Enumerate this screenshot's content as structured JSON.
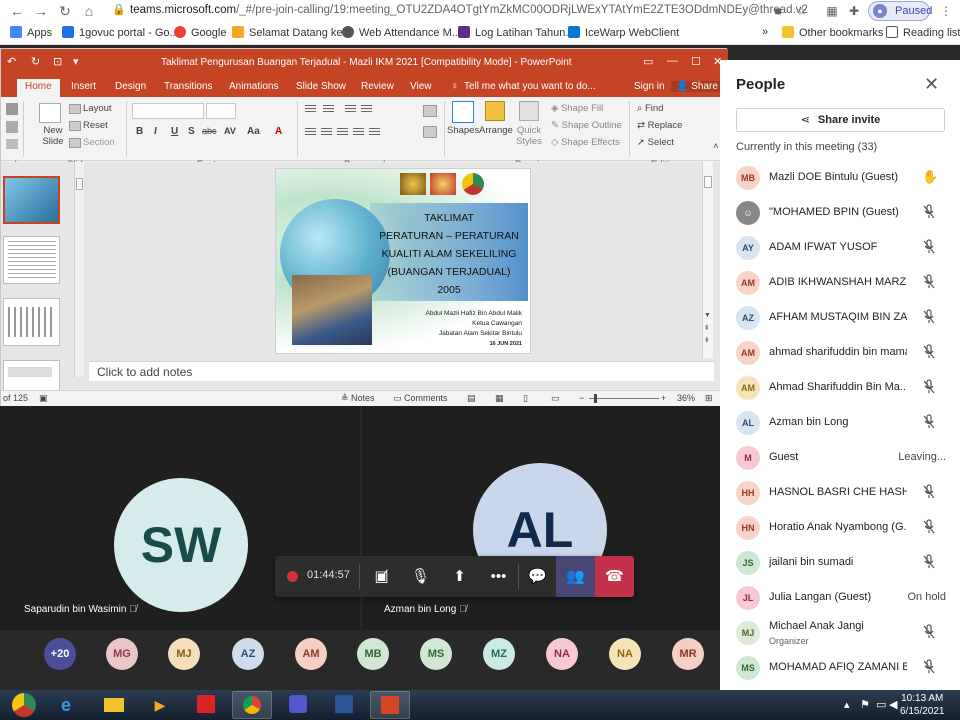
{
  "browser": {
    "url_main": "teams.microsoft.com",
    "url_rest": "/_#/pre-join-calling/19:meeting_OTU2ZDA4OTgtYmZkMC00ODRjLWExYTAtYmE2ZTE3ODdmNDEy@thread.v2",
    "paused_label": "Paused",
    "bookmarks": [
      {
        "label": "Apps",
        "color": "#4285f4"
      },
      {
        "label": "1govuc portal - Go...",
        "color": "#1a73e8"
      },
      {
        "label": "Google",
        "color": "#ea4335"
      },
      {
        "label": "Selamat Datang ke...",
        "color": "#f9a825"
      },
      {
        "label": "Web Attendance M...",
        "color": "#555555"
      },
      {
        "label": "Log Latihan Tahun...",
        "color": "#5c2d91"
      },
      {
        "label": "IceWarp WebClient",
        "color": "#0078d4"
      }
    ],
    "other_bookmarks": "Other bookmarks",
    "reading_list": "Reading list",
    "more": "»"
  },
  "ppt": {
    "title": "Taklimat Pengurusan Buangan Terjadual - Mazli IKM 2021 [Compatibility Mode] - PowerPoint",
    "tabs": [
      "Home",
      "Insert",
      "Design",
      "Transitions",
      "Animations",
      "Slide Show",
      "Review",
      "View"
    ],
    "tell_me": "Tell me what you want to do...",
    "sign_in": "Sign in",
    "share": "Share",
    "ribbon": {
      "new_slide": "New Slide",
      "layout": "Layout",
      "reset": "Reset",
      "section": "Section",
      "slides_group": "Slides",
      "font_group": "Font",
      "paragraph_group": "Paragraph",
      "shapes": "Shapes",
      "arrange": "Arrange",
      "quick_styles": "Quick Styles",
      "shape_fill": "Shape Fill",
      "shape_outline": "Shape Outline",
      "shape_effects": "Shape Effects",
      "drawing_group": "Drawing",
      "find": "Find",
      "replace": "Replace",
      "select": "Select",
      "editing_group": "Editing",
      "clipboard_group": "ard"
    },
    "slide": {
      "line1": "TAKLIMAT",
      "line2": "PERATURAN – PERATURAN",
      "line3": "KUALITI ALAM SEKELILING",
      "line4": "(BUANGAN TERJADUAL)",
      "line5": "2005",
      "presenter": "Abdul Mazli Hafiz Bin Abdul Malik",
      "position": "Ketua Cawangan",
      "department": "Jabatan Alam Sekitar Bintulu",
      "date": "16 JUN 2021"
    },
    "notes_placeholder": "Click to add notes",
    "status": {
      "slide_count": "of 125",
      "notes": "Notes",
      "comments": "Comments",
      "zoom": "36%"
    }
  },
  "meeting": {
    "timer": "01:44:57",
    "tiles": [
      {
        "initials": "SW",
        "name": "Saparudin bin Wasimin"
      },
      {
        "initials": "AL",
        "name": "Azman bin Long"
      }
    ],
    "overflow_count": "+20",
    "row_avatars": [
      {
        "initials": "MG",
        "bg": "#e9c6c8",
        "fg": "#8a3a42"
      },
      {
        "initials": "MJ",
        "bg": "#f6dfbb",
        "fg": "#8a5a12"
      },
      {
        "initials": "AZ",
        "bg": "#cfdcec",
        "fg": "#2e4d72"
      },
      {
        "initials": "AM",
        "bg": "#f5cfc2",
        "fg": "#8a3a22"
      },
      {
        "initials": "MB",
        "bg": "#cfe7d3",
        "fg": "#2d6a3a"
      },
      {
        "initials": "MS",
        "bg": "#cfe7d3",
        "fg": "#2d6a3a"
      },
      {
        "initials": "MZ",
        "bg": "#c9ebe3",
        "fg": "#1f6e5c"
      },
      {
        "initials": "NA",
        "bg": "#f7c9d3",
        "fg": "#8a2e45"
      },
      {
        "initials": "NA",
        "bg": "#f6e3b9",
        "fg": "#8a6a12"
      },
      {
        "initials": "MR",
        "bg": "#f5cfc2",
        "fg": "#8a3a22"
      }
    ]
  },
  "people": {
    "title": "People",
    "share_invite": "Share invite",
    "currently": "Currently in this meeting (33)",
    "participants": [
      {
        "initials": "MB",
        "name": "Mazli DOE Bintulu (Guest)",
        "status": "hand",
        "bg": "#f8d4c8",
        "fg": "#9a3a22"
      },
      {
        "initials": "",
        "name": "\"MOHAMED BPIN (Guest)",
        "status": "muted",
        "bg": "#8a8886",
        "fg": "#ffffff"
      },
      {
        "initials": "AY",
        "name": "ADAM IFWAT YUSOF",
        "status": "muted",
        "bg": "#d8e4f0",
        "fg": "#2e4d72"
      },
      {
        "initials": "AM",
        "name": "ADIB IKHWANSHAH MARZU...",
        "status": "muted",
        "bg": "#f8d4c8",
        "fg": "#9a3a22"
      },
      {
        "initials": "AZ",
        "name": "AFHAM MUSTAQIM BIN ZA...",
        "status": "muted",
        "bg": "#d8e4f0",
        "fg": "#2e4d72"
      },
      {
        "initials": "AM",
        "name": "ahmad sharifuddin bin mamat",
        "status": "muted",
        "bg": "#f8d4c8",
        "fg": "#9a3a22"
      },
      {
        "initials": "AM",
        "name": "Ahmad Sharifuddin Bin Ma...",
        "status": "muted",
        "bg": "#f6e3b9",
        "fg": "#8a6a12"
      },
      {
        "initials": "AL",
        "name": "Azman bin Long",
        "status": "muted",
        "bg": "#d8e4f0",
        "fg": "#2e4d72"
      },
      {
        "initials": "M",
        "name": "Guest",
        "status": "Leaving...",
        "bg": "#f7c9d3",
        "fg": "#8a2e45"
      },
      {
        "initials": "HH",
        "name": "HASNOL BASRI CHE HASHIM",
        "status": "muted",
        "bg": "#f8d4c8",
        "fg": "#9a3a22"
      },
      {
        "initials": "HN",
        "name": "Horatio Anak Nyambong (G...",
        "status": "muted",
        "bg": "#f8d4c8",
        "fg": "#9a3a22"
      },
      {
        "initials": "JS",
        "name": "jailani bin sumadi",
        "status": "muted",
        "bg": "#cfe7d3",
        "fg": "#2d6a3a"
      },
      {
        "initials": "JL",
        "name": "Julia Langan (Guest)",
        "status": "On hold",
        "bg": "#f7c9d3",
        "fg": "#8a2e45"
      },
      {
        "initials": "MJ",
        "name": "Michael Anak Jangi",
        "sub": "Organizer",
        "status": "muted",
        "bg": "#e0e8d8",
        "fg": "#4a6a2a"
      },
      {
        "initials": "MS",
        "name": "MOHAMAD AFIQ ZAMANI B...",
        "status": "muted",
        "bg": "#cfe7d3",
        "fg": "#2d6a3a"
      }
    ]
  },
  "taskbar": {
    "time": "10:13 AM",
    "date": "6/15/2021"
  }
}
